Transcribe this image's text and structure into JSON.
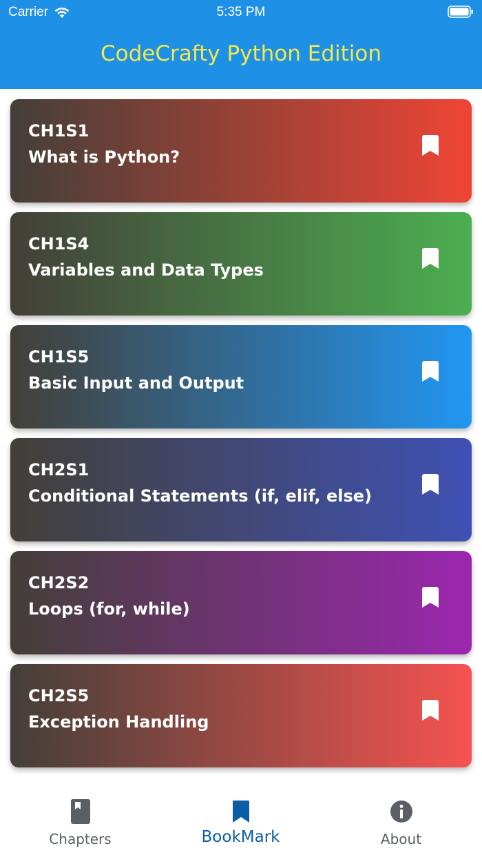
{
  "status_bar": {
    "carrier": "Carrier",
    "time": "5:35 PM",
    "icons": [
      "wifi-icon",
      "battery-icon"
    ]
  },
  "header": {
    "title": "CodeCrafty Python Edition",
    "background": "#1e90e6",
    "title_color": "#f4e84a"
  },
  "cards": [
    {
      "code": "CH1S1",
      "title": "What is Python?",
      "accent": "#ef4435",
      "icon": "bookmark-icon"
    },
    {
      "code": "CH1S4",
      "title": "Variables and Data Types",
      "accent": "#4caf50",
      "icon": "bookmark-icon"
    },
    {
      "code": "CH1S5",
      "title": "Basic Input and Output",
      "accent": "#2196f3",
      "icon": "bookmark-icon"
    },
    {
      "code": "CH2S1",
      "title": "Conditional Statements (if, elif, else)",
      "accent": "#3f51b5",
      "icon": "bookmark-icon"
    },
    {
      "code": "CH2S2",
      "title": "Loops (for, while)",
      "accent": "#9c27b0",
      "icon": "bookmark-icon"
    },
    {
      "code": "CH2S5",
      "title": "Exception Handling",
      "accent": "#f55350",
      "icon": "bookmark-icon"
    }
  ],
  "card_gradient_start": "#433f38",
  "bottom_nav": {
    "items": [
      {
        "label": "Chapters",
        "icon": "book-icon",
        "active": false
      },
      {
        "label": "BookMark",
        "icon": "bookmark-icon",
        "active": true
      },
      {
        "label": "About",
        "icon": "info-icon",
        "active": false
      }
    ],
    "active_color": "#0b5da8",
    "inactive_color": "#5a5f66"
  }
}
